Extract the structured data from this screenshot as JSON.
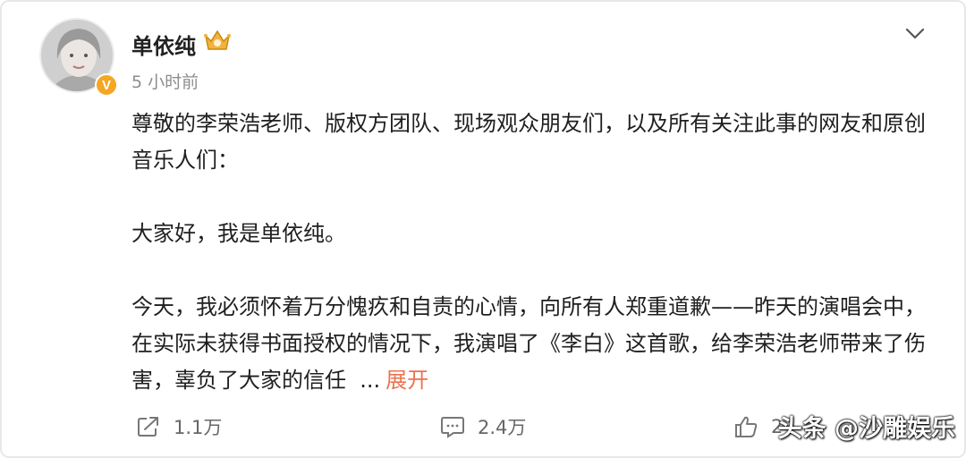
{
  "post": {
    "author": "单依纯",
    "time": "5 小时前",
    "paragraphs": [
      "尊敬的李荣浩老师、版权方团队、现场观众朋友们，以及所有关注此事的网友和原创音乐人们：",
      "大家好，我是单依纯。",
      "今天，我必须怀着万分愧疚和自责的心情，向所有人郑重道歉——昨天的演唱会中，在实际未获得书面授权的情况下，我演唱了《李白》这首歌，给李荣浩老师带来了伤害，辜负了大家的信任"
    ],
    "ellipsis": "...",
    "expand_label": "展开"
  },
  "actions": {
    "share_count": "1.1万",
    "comment_count": "2.4万",
    "like_count": "2"
  },
  "watermark": "头条 @沙雕娱乐",
  "icons": {
    "verified": "v-badge-icon",
    "vip": "vip-crown-icon",
    "more": "chevron-down-icon",
    "share": "share-icon",
    "comment": "comment-icon",
    "like": "thumb-up-icon"
  },
  "colors": {
    "expand": "#eb7350",
    "verified_badge": "#f5a623",
    "muted_text": "#8d8d8d"
  }
}
